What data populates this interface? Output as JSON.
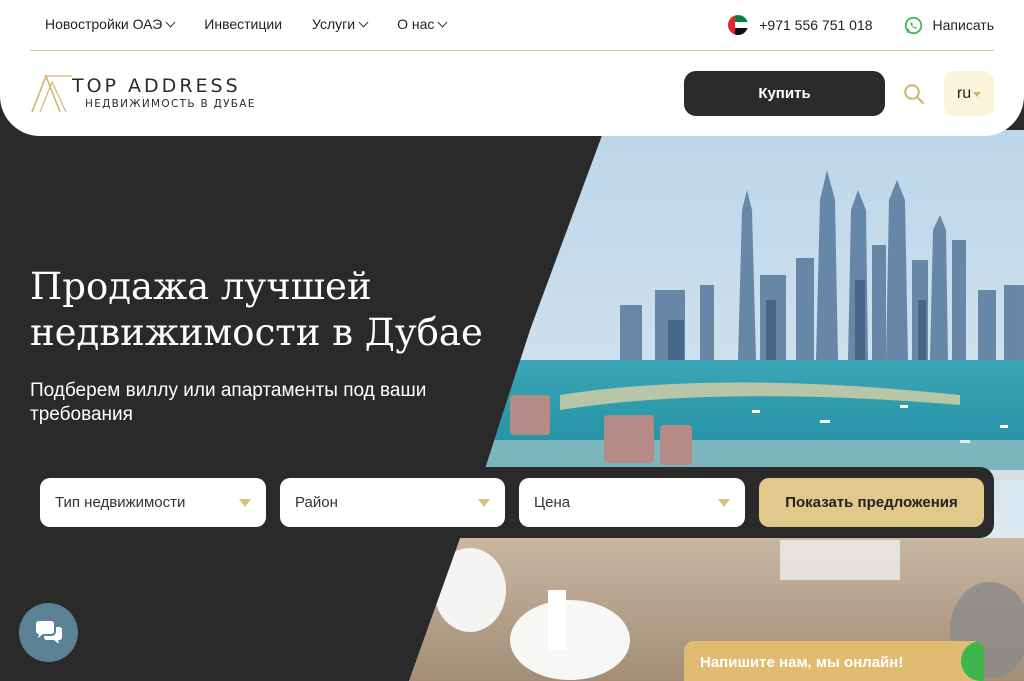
{
  "nav": {
    "items": [
      {
        "label": "Новостройки ОАЭ",
        "has_dropdown": true
      },
      {
        "label": "Инвестиции",
        "has_dropdown": false
      },
      {
        "label": "Услуги",
        "has_dropdown": true
      },
      {
        "label": "О нас",
        "has_dropdown": true
      }
    ]
  },
  "contacts": {
    "flag_icon": "uae-flag-icon",
    "phone": "+971 556 751 018",
    "whatsapp_icon": "whatsapp-icon",
    "write_label": "Написать"
  },
  "logo": {
    "title": "TOP ADDRESS",
    "subtitle": "НЕДВИЖИМОСТЬ В ДУБАЕ"
  },
  "header": {
    "buy_label": "Купить",
    "search_icon": "search-icon",
    "lang": "ru"
  },
  "hero": {
    "title": "Продажа лучшей недвижимости в Дубае",
    "subtitle": "Подберем виллу или апартаменты под ваши требования"
  },
  "search": {
    "type_placeholder": "Тип недвижимости",
    "district_placeholder": "Район",
    "price_placeholder": "Цена",
    "submit_label": "Показать предложения"
  },
  "chat": {
    "icon": "chat-icon",
    "online_label": "Напишите нам, мы онлайн!"
  },
  "colors": {
    "dark": "#2a2a2a",
    "gold": "#e2c88a",
    "gold_accent": "#d9c27e",
    "lang_bg": "#fcf3dc",
    "chat_blue": "#5a8194",
    "online_orange": "#e2bb72",
    "online_green": "#3cb54a"
  }
}
